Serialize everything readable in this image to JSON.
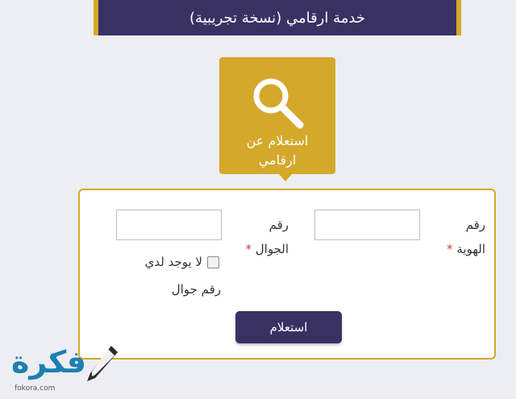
{
  "header": {
    "title": "خدمة ارقامي (نسخة تجريبية)"
  },
  "service_tile": {
    "label": "استعلام عن ارقامي",
    "icon": "search-icon",
    "color": "#d4a82a"
  },
  "form": {
    "id_label": "رقم الهوية",
    "mobile_label": "رقم الجوال",
    "required_mark": "*",
    "id_value": "",
    "mobile_value": "",
    "no_mobile_checkbox": {
      "label": "لا يوجد لدي رقم جوال",
      "checked": false
    },
    "submit_label": "استعلام"
  },
  "watermark": {
    "text": "فكرة",
    "url": "fokora.com"
  },
  "colors": {
    "primary": "#3a3163",
    "accent": "#d4a82a",
    "required": "#d1383a"
  }
}
